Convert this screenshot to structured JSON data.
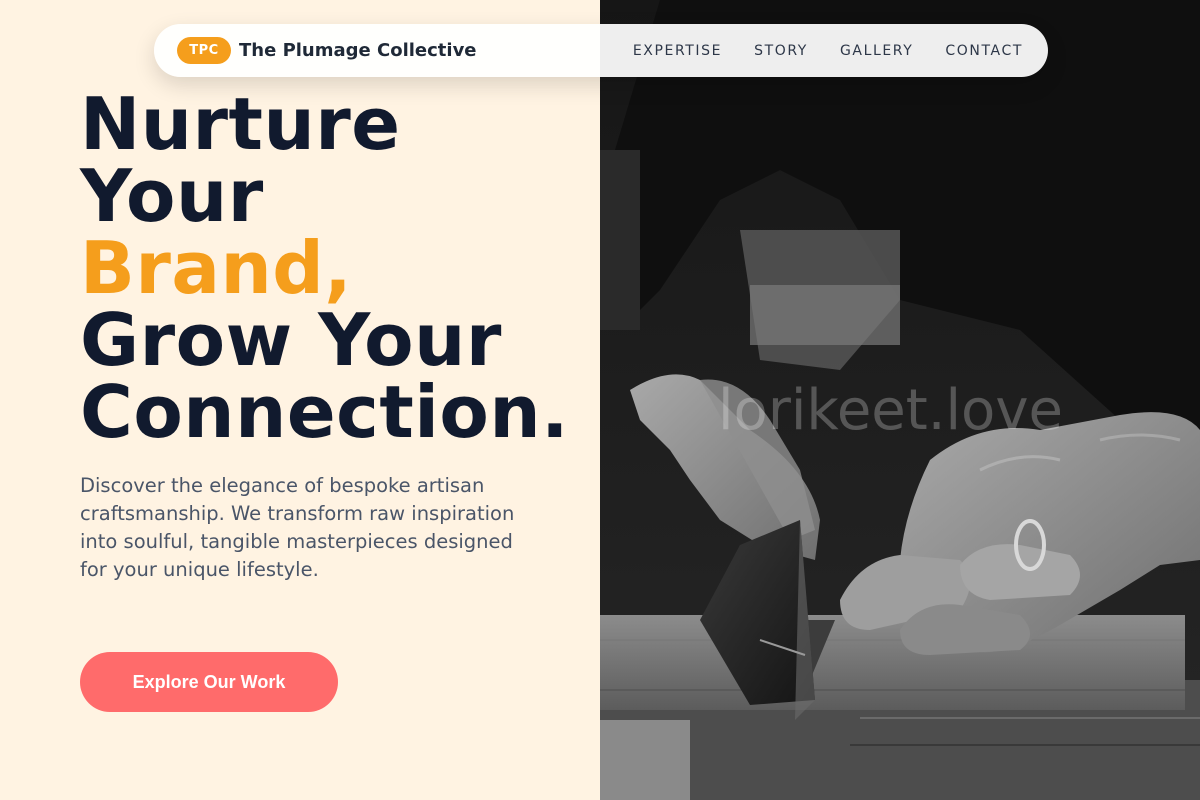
{
  "header": {
    "logo_badge": "TPC",
    "brand_name": "The Plumage Collective",
    "nav_items": [
      "EXPERTISE",
      "STORY",
      "GALLERY",
      "CONTACT"
    ]
  },
  "hero": {
    "headline_line1": "Nurture",
    "headline_line2": "Your",
    "headline_accent": "Brand,",
    "headline_line4": "Grow Your",
    "headline_line5": "Connection.",
    "description": "Discover the elegance of bespoke artisan craftsmanship. We transform raw inspiration into soulful, tangible masterpieces designed for your unique lifestyle.",
    "cta_label": "Explore Our Work"
  },
  "image": {
    "watermark": "lorikeet.love"
  },
  "colors": {
    "background": "#fff3e2",
    "heading": "#111a2e",
    "accent": "#f59e1c",
    "cta": "#ff6b6b",
    "body_text": "#4a5568"
  }
}
